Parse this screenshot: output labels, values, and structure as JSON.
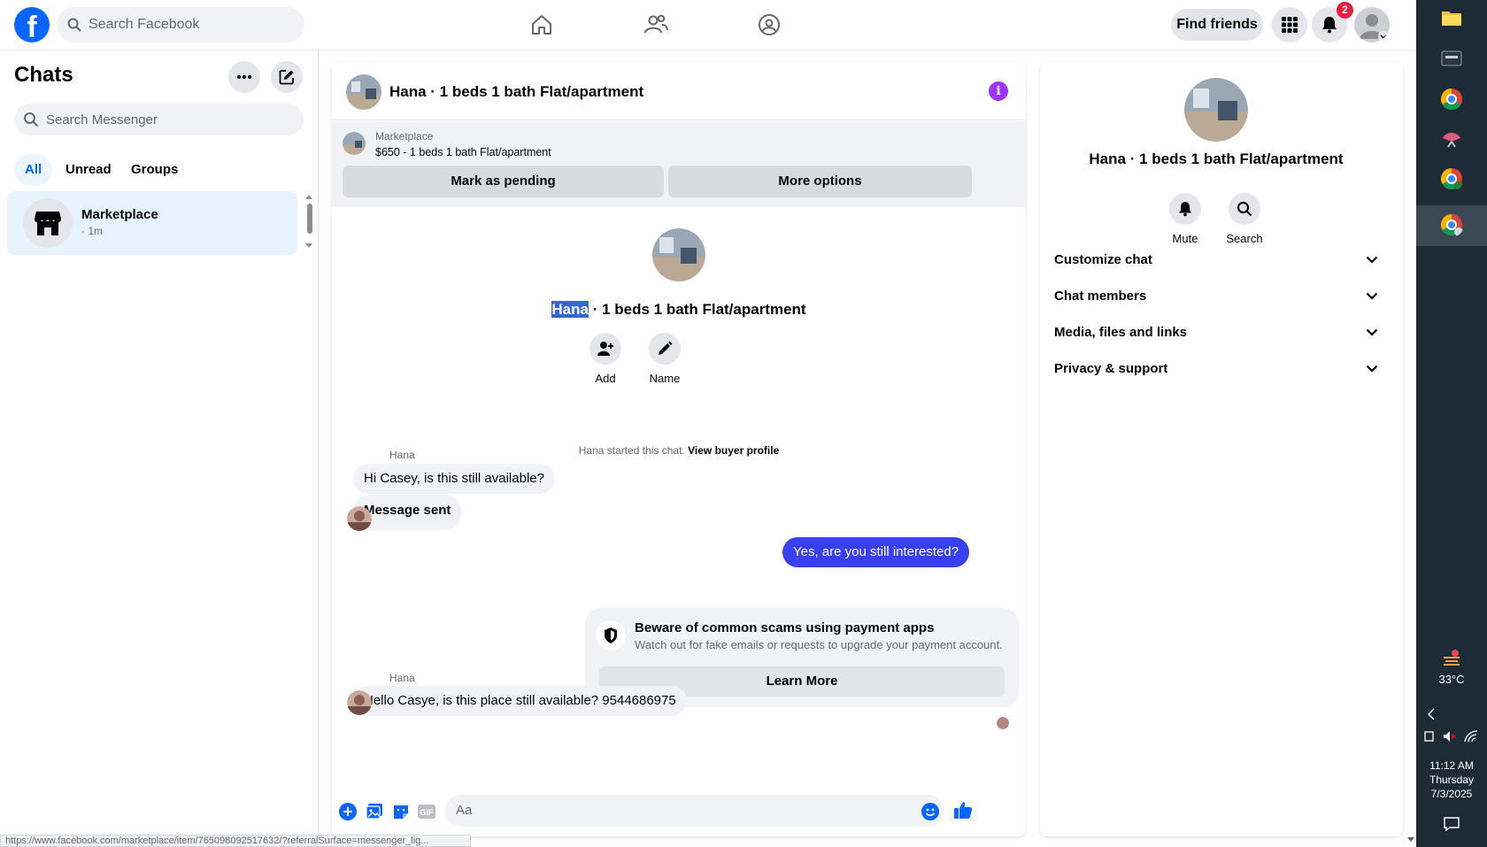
{
  "topbar": {
    "logo": "f",
    "search_placeholder": "Search Facebook",
    "find_friends": "Find friends",
    "notification_count": "2"
  },
  "left": {
    "title": "Chats",
    "search_placeholder": "Search Messenger",
    "filters": [
      "All",
      "Unread",
      "Groups"
    ],
    "active_filter": "All",
    "chats": [
      {
        "name": "Marketplace",
        "time": "· 1m"
      }
    ]
  },
  "conversation": {
    "title": "Hana · 1 beds 1 bath Flat/apartment",
    "listing": {
      "label": "Marketplace",
      "price_line": "$650 - 1 beds 1 bath Flat/apartment",
      "mark_pending": "Mark as pending",
      "more_options": "More options"
    },
    "intro": {
      "title_highlight": "Hana",
      "title_rest": " · 1 beds 1 bath Flat/apartment",
      "add_label": "Add",
      "name_label": "Name"
    },
    "started_text": "Hana started this chat.",
    "view_buyer_profile": "View buyer profile",
    "messages": [
      {
        "sender": "Hana",
        "text": "Hi Casey, is this still available?"
      },
      {
        "sender": "",
        "text": "Message sent"
      },
      {
        "sender": "me",
        "text": "Yes, are you still interested?"
      },
      {
        "sender": "Hana",
        "text": "Hello Casye, is this place still available? 9544686975"
      }
    ],
    "scam_warning": {
      "title": "Beware of common scams using payment apps",
      "subtitle": "Watch out for fake emails or requests to upgrade your payment account.",
      "button": "Learn More"
    },
    "composer_placeholder": "Aa",
    "accent": "#0866ff",
    "my_bubble_color": "#3940f1"
  },
  "details": {
    "title": "Hana · 1 beds 1 bath Flat/apartment",
    "mute": "Mute",
    "search": "Search",
    "sections": [
      "Customize chat",
      "Chat members",
      "Media, files and links",
      "Privacy & support"
    ]
  },
  "taskbar": {
    "weather_temp": "33°C",
    "time": "11:12 AM",
    "day": "Thursday",
    "date": "7/3/2025"
  },
  "status_url": "https://www.facebook.com/marketplace/item/765098092517632/?referralSurface=messenger_lig..."
}
